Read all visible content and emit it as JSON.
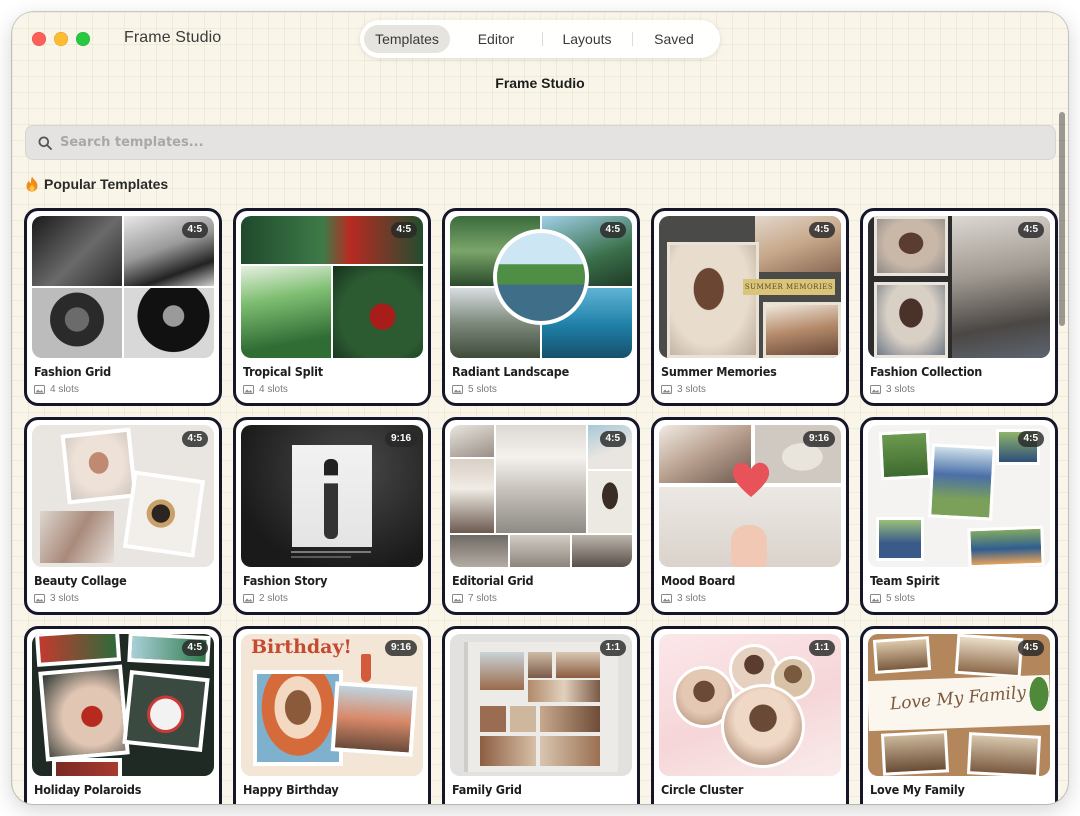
{
  "app": {
    "name": "Frame Studio",
    "title": "Frame Studio"
  },
  "nav": {
    "tabs": [
      "Templates",
      "Editor",
      "Layouts",
      "Saved"
    ],
    "active": "Templates"
  },
  "search": {
    "placeholder": "Search templates..."
  },
  "section": {
    "icon": "flame-icon",
    "title": "Popular Templates"
  },
  "templates": [
    {
      "name": "Fashion Grid",
      "ratio": "4:5",
      "slots": "4 slots",
      "style": "grid"
    },
    {
      "name": "Tropical Split",
      "ratio": "4:5",
      "slots": "4 slots",
      "style": "split"
    },
    {
      "name": "Radiant Landscape",
      "ratio": "4:5",
      "slots": "5 slots",
      "style": "circle-center"
    },
    {
      "name": "Summer Memories",
      "ratio": "4:5",
      "slots": "3 slots",
      "style": "banner"
    },
    {
      "name": "Fashion Collection",
      "ratio": "4:5",
      "slots": "3 slots",
      "style": "collection"
    },
    {
      "name": "Beauty Collage",
      "ratio": "4:5",
      "slots": "3 slots",
      "style": "scatter"
    },
    {
      "name": "Fashion Story",
      "ratio": "9:16",
      "slots": "2 slots",
      "style": "story"
    },
    {
      "name": "Editorial Grid",
      "ratio": "4:5",
      "slots": "7 slots",
      "style": "editorial"
    },
    {
      "name": "Mood Board",
      "ratio": "9:16",
      "slots": "3 slots",
      "style": "mood"
    },
    {
      "name": "Team Spirit",
      "ratio": "4:5",
      "slots": "5 slots",
      "style": "team"
    },
    {
      "name": "Holiday Polaroids",
      "ratio": "4:5",
      "slots": "",
      "style": "polaroids"
    },
    {
      "name": "Happy Birthday",
      "ratio": "9:16",
      "slots": "",
      "style": "birthday"
    },
    {
      "name": "Family Grid",
      "ratio": "1:1",
      "slots": "",
      "style": "family-grid"
    },
    {
      "name": "Circle Cluster",
      "ratio": "1:1",
      "slots": "",
      "style": "circles"
    },
    {
      "name": "Love My Family",
      "ratio": "4:5",
      "slots": "",
      "style": "love"
    }
  ],
  "thumb_text": {
    "summer_banner": "SUMMER MEMORIES",
    "birthday_heading": "Birthday!",
    "love_family": "Love My Family"
  },
  "colors": {
    "card_border": "#16162a",
    "window_bg": "#f9f6e9",
    "badge_bg": "#282828"
  }
}
